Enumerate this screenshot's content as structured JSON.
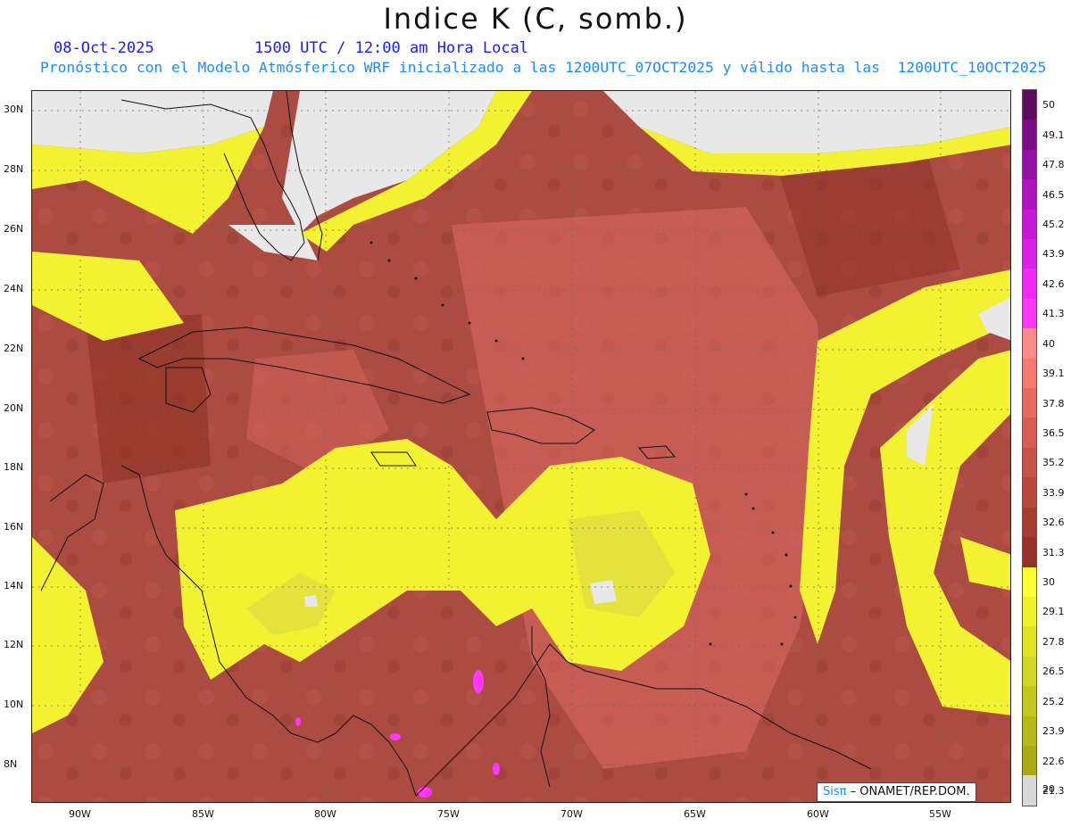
{
  "header": {
    "title": "Indice K (C, somb.)",
    "date": "08-Oct-2025",
    "time": "1500 UTC / 12:00 am Hora Local",
    "subtitle": "Pronóstico con el Modelo Atmósferico WRF inicializado a las 1200UTC_07OCT2025 y válido hasta las  1200UTC_10OCT2025"
  },
  "map": {
    "lat_labels": [
      "30N",
      "28N",
      "26N",
      "24N",
      "22N",
      "20N",
      "18N",
      "16N",
      "14N",
      "12N",
      "10N",
      "8N"
    ],
    "lon_labels": [
      "90W",
      "85W",
      "80W",
      "75W",
      "70W",
      "65W",
      "60W",
      "55W"
    ]
  },
  "colorbar": {
    "labels": [
      "50",
      "49.1",
      "47.8",
      "46.5",
      "45.2",
      "43.9",
      "42.6",
      "41.3",
      "40",
      "39.1",
      "37.8",
      "36.5",
      "35.2",
      "33.9",
      "32.6",
      "31.3",
      "30",
      "29.1",
      "27.8",
      "26.5",
      "25.2",
      "23.9",
      "22.6",
      "21.3",
      "20"
    ],
    "colors": [
      "#5e0a5e",
      "#7b0d84",
      "#9410a3",
      "#ad14c0",
      "#c718d6",
      "#dd20e6",
      "#f02af3",
      "#ff36ff",
      "#ff8a8a",
      "#f47a72",
      "#e66c62",
      "#d85e54",
      "#c95248",
      "#b8473e",
      "#a73c33",
      "#95302a",
      "#ffff33",
      "#f0f02c",
      "#e2e227",
      "#d4d422",
      "#c6c61e",
      "#b8b81a",
      "#aaaa16",
      "#d9d9d9"
    ]
  },
  "credit": {
    "sis": "Sisπ",
    "rest": "– ONAMET/REP.DOM."
  }
}
